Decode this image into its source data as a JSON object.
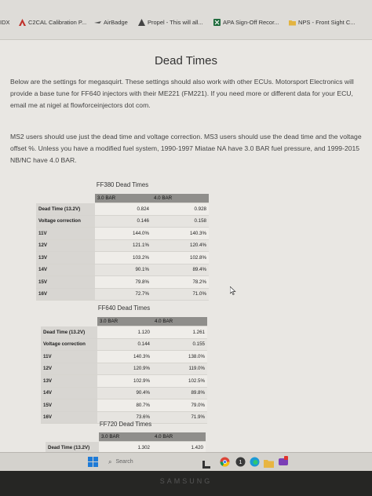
{
  "bookmarks": {
    "idx": "IDX",
    "c2cal": "C2CAL Calibration P...",
    "airbadge": "AirBadge",
    "propel": "Propel - This will all...",
    "apa": "APA Sign-Off Recor...",
    "nps": "NPS - Front Sight C..."
  },
  "page": {
    "title": "Dead Times",
    "intro": "Below are the settings for megasquirt. These settings should also work with other ECUs. Motorsport Electronics will provide a base tune for FF640 injectors with their ME221 (FM221). If you need more or different data for your ECU, email me at nigel at flowforceinjectors dot com.",
    "ms_note": "MS2 users should use just the dead time and voltage correction. MS3 users should use the dead time and the voltage offset %. Unless you have a modified fuel system, 1990-1997 Miatae NA have 3.0 BAR fuel pressure, and 1999-2015 NB/NC have 4.0 BAR."
  },
  "tables": {
    "ff380": {
      "title": "FF380 Dead Times",
      "col1": "3.0 BAR",
      "col2": "4.0 BAR",
      "rows": [
        [
          "Dead Time (13.2V)",
          "0.824",
          "0.928"
        ],
        [
          "Voltage correction",
          "0.146",
          "0.158"
        ],
        [
          "11V",
          "144.0%",
          "140.3%"
        ],
        [
          "12V",
          "121.1%",
          "120.4%"
        ],
        [
          "13V",
          "103.2%",
          "102.8%"
        ],
        [
          "14V",
          "90.1%",
          "89.4%"
        ],
        [
          "15V",
          "79.8%",
          "78.2%"
        ],
        [
          "16V",
          "72.7%",
          "71.0%"
        ]
      ]
    },
    "ff640": {
      "title": "FF640 Dead Times",
      "col1": "3.0 BAR",
      "col2": "4.0 BAR",
      "rows": [
        [
          "Dead Time (13.2V)",
          "1.120",
          "1.261"
        ],
        [
          "Voltage correction",
          "0.144",
          "0.155"
        ],
        [
          "11V",
          "140.3%",
          "138.0%"
        ],
        [
          "12V",
          "120.9%",
          "119.0%"
        ],
        [
          "13V",
          "102.9%",
          "102.5%"
        ],
        [
          "14V",
          "90.4%",
          "89.8%"
        ],
        [
          "15V",
          "80.7%",
          "79.0%"
        ],
        [
          "16V",
          "73.6%",
          "71.9%"
        ]
      ]
    },
    "ff720": {
      "title": "FF720 Dead Times",
      "col1": "3.0 BAR",
      "col2": "4.0 BAR",
      "rows": [
        [
          "Dead Time (13.2V)",
          "1.302",
          "1.420"
        ]
      ]
    }
  },
  "taskbar": {
    "search": "Search"
  },
  "monitor": {
    "brand": "SAMSUNG"
  },
  "colors": {
    "header_bg": "#8f8e8b",
    "label_bg": "#d8d6d2",
    "page_bg": "#e9e7e3"
  }
}
